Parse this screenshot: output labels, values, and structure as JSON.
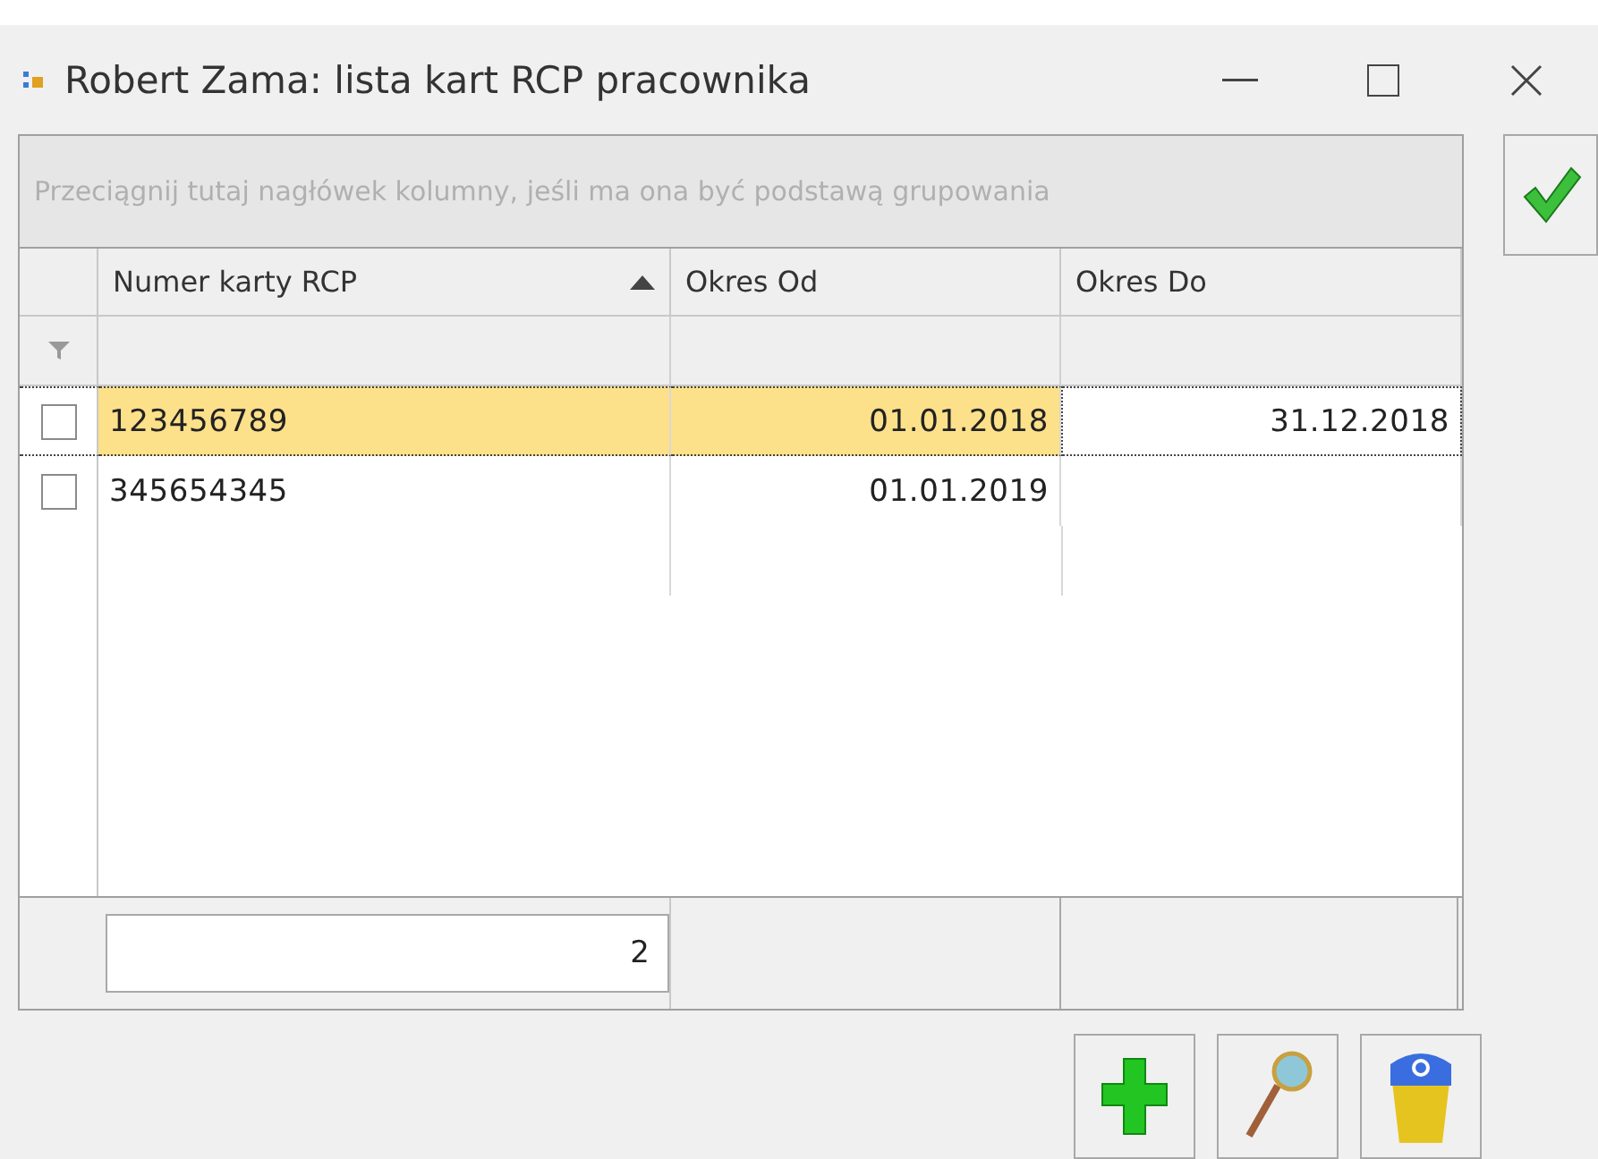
{
  "window": {
    "title": "Robert Zama: lista kart RCP pracownika"
  },
  "group_panel": {
    "text": "Przeciągnij tutaj nagłówek kolumny, jeśli ma ona być podstawą grupowania"
  },
  "columns": [
    {
      "label": "Numer karty RCP",
      "sorted": true
    },
    {
      "label": "Okres Od",
      "sorted": false
    },
    {
      "label": "Okres Do",
      "sorted": false
    }
  ],
  "rows": [
    {
      "selected": true,
      "checked": false,
      "cells": [
        {
          "text": "123456789",
          "focused": false
        },
        {
          "text": "01.01.2018",
          "focused": false
        },
        {
          "text": "31.12.2018",
          "focused": true
        }
      ]
    },
    {
      "selected": false,
      "checked": false,
      "cells": [
        {
          "text": "345654345",
          "focused": false
        },
        {
          "text": "01.01.2019",
          "focused": false
        },
        {
          "focused": false
        }
      ]
    }
  ],
  "footer": {
    "count": "2"
  }
}
